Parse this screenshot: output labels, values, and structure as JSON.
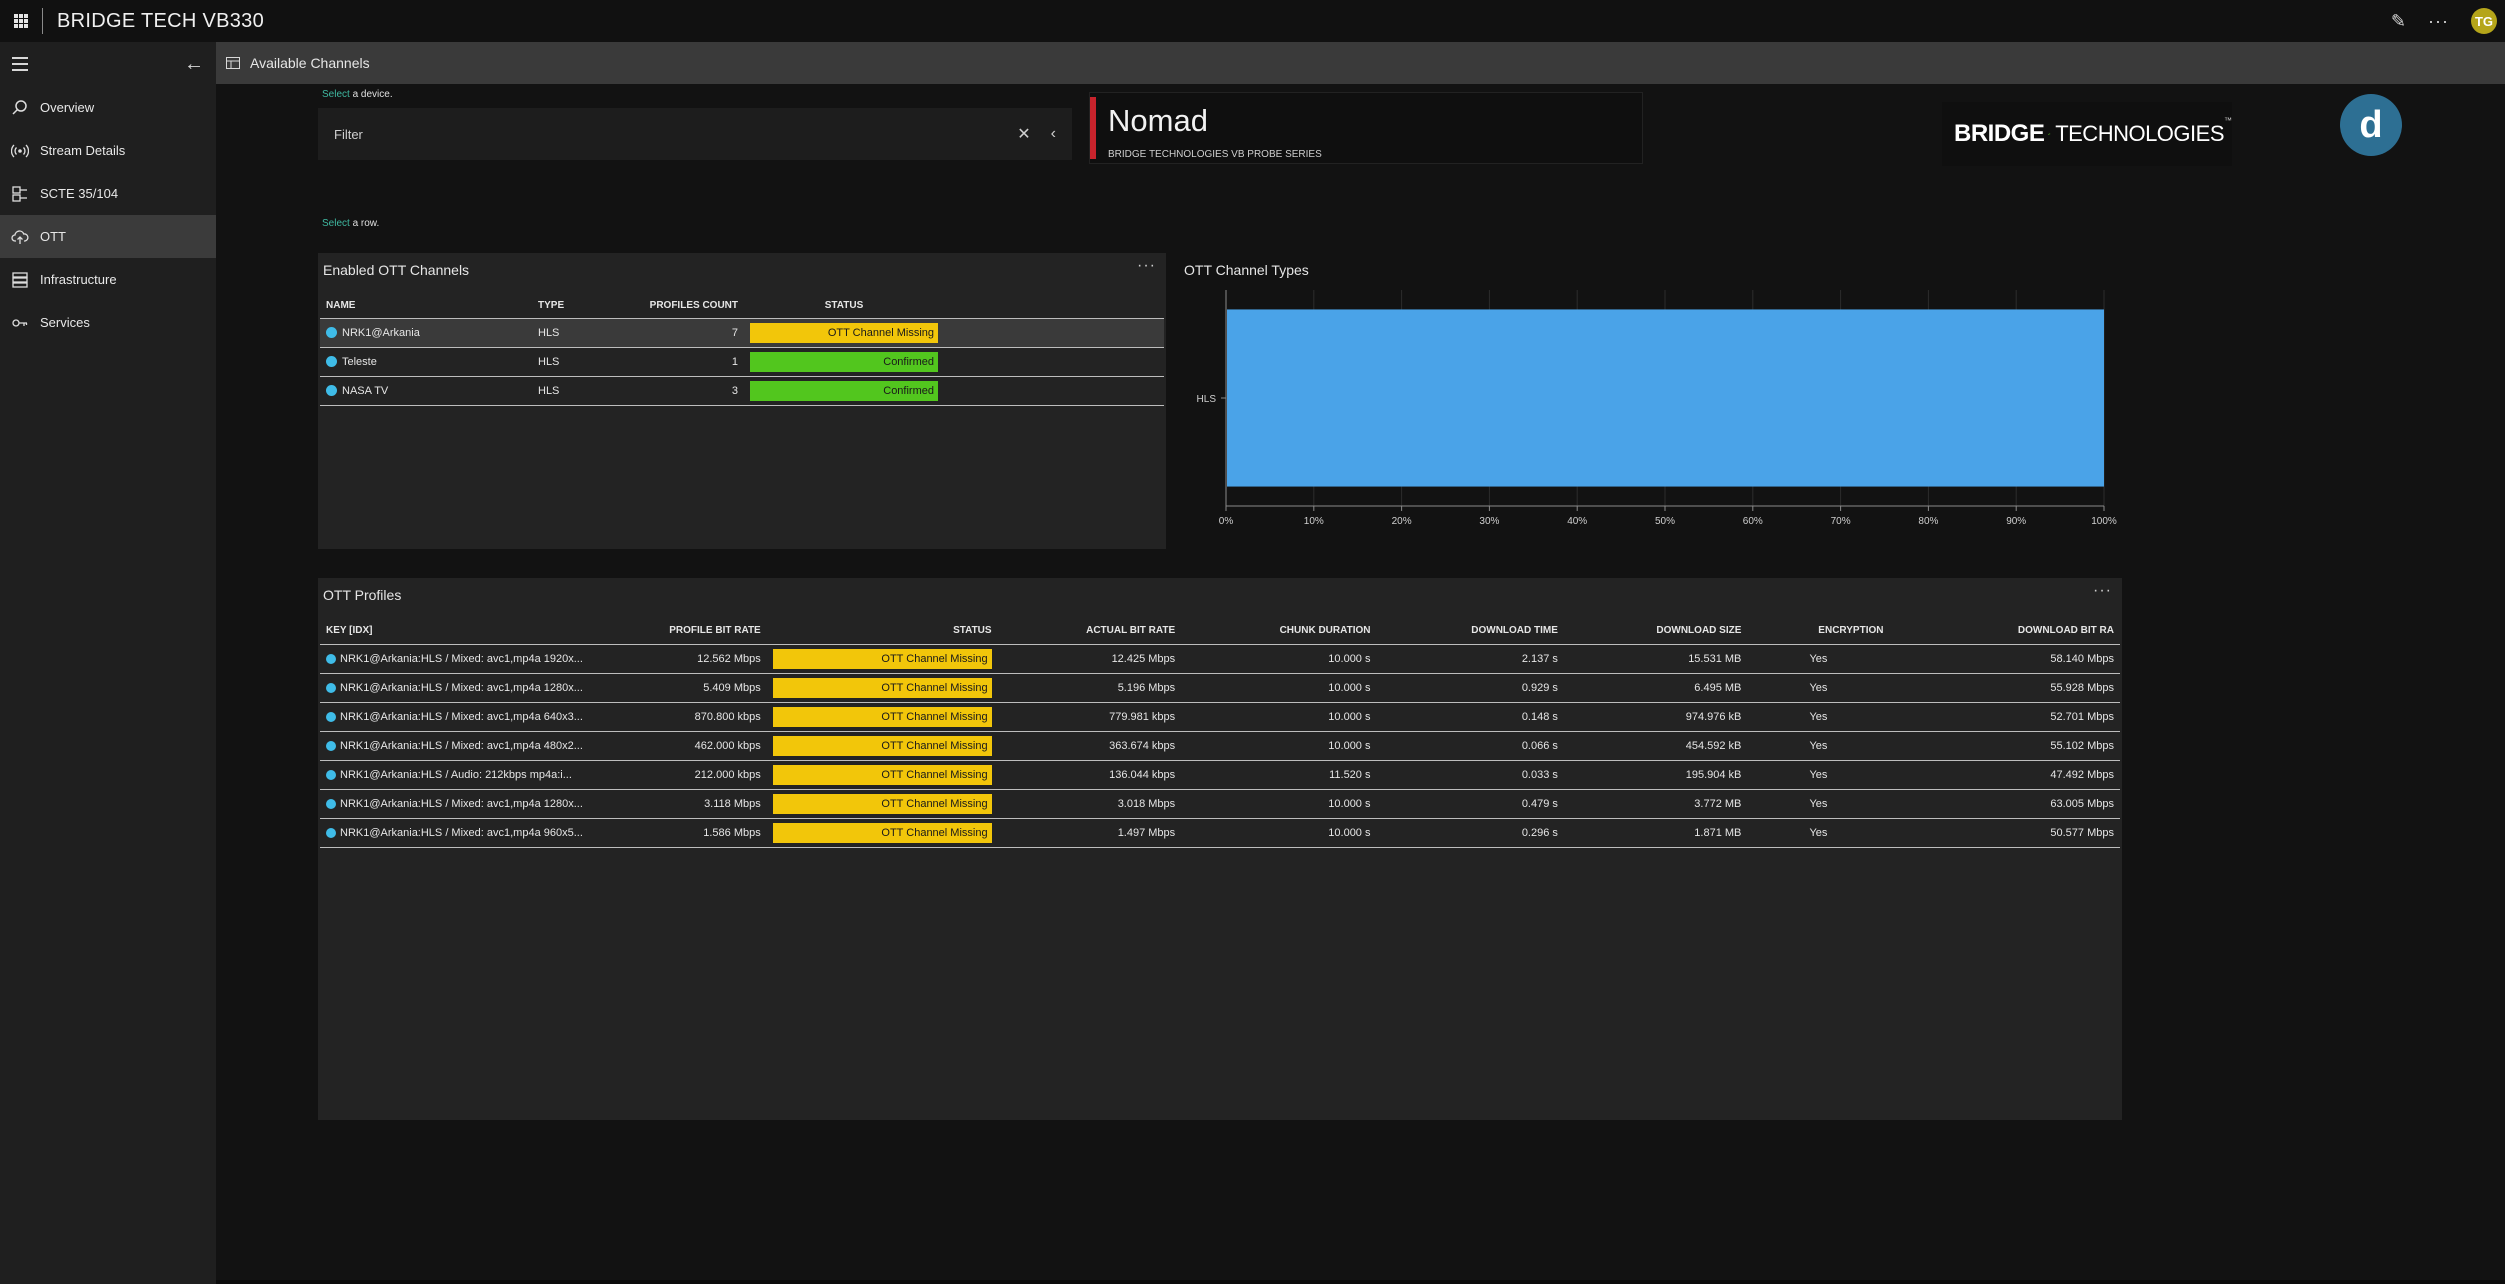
{
  "app": {
    "title": "BRIDGE TECH VB330",
    "user_initials": "TG"
  },
  "icons": {
    "apps": "waffle-icon",
    "edit": "pencil-icon",
    "more": "ellipsis-icon",
    "menu": "hamburger-icon",
    "back": "arrow-left-icon"
  },
  "sidebar": {
    "items": [
      {
        "label": "Overview",
        "icon": "search-icon"
      },
      {
        "label": "Stream Details",
        "icon": "broadcast-icon"
      },
      {
        "label": "SCTE 35/104",
        "icon": "splice-icon"
      },
      {
        "label": "OTT",
        "icon": "cloud-upload-icon",
        "active": true
      },
      {
        "label": "Infrastructure",
        "icon": "server-icon"
      },
      {
        "label": "Services",
        "icon": "key-icon"
      }
    ]
  },
  "subheader": {
    "title": "Available Channels"
  },
  "hints": {
    "device": {
      "accent": "Select",
      "rest": " a device."
    },
    "row": {
      "accent": "Select",
      "rest": " a row."
    }
  },
  "filter": {
    "placeholder": "Filter"
  },
  "device": {
    "name": "Nomad",
    "subtitle": "BRIDGE TECHNOLOGIES VB PROBE SERIES"
  },
  "brand": {
    "word1": "BRIDGE",
    "word2": "TECHNOLOGIES",
    "tm": "™",
    "d_logo": "d"
  },
  "colors": {
    "accent": "#3fb8a0",
    "missing": "#f2c60a",
    "confirmed": "#52c61e",
    "bar": "#4aa3e8",
    "dot": "#3fbce8",
    "device_bar": "#c8232c"
  },
  "channels": {
    "title": "Enabled OTT Channels",
    "menu": "···",
    "columns": [
      "NAME",
      "TYPE",
      "PROFILES COUNT",
      "STATUS"
    ],
    "rows": [
      {
        "name": "NRK1@Arkania",
        "type": "HLS",
        "profiles": "7",
        "status": "OTT Channel Missing",
        "status_type": "missing",
        "selected": true
      },
      {
        "name": "Teleste",
        "type": "HLS",
        "profiles": "1",
        "status": "Confirmed",
        "status_type": "confirmed"
      },
      {
        "name": "NASA TV",
        "type": "HLS",
        "profiles": "3",
        "status": "Confirmed",
        "status_type": "confirmed"
      }
    ]
  },
  "chart_data": {
    "type": "bar",
    "title": "OTT Channel Types",
    "orientation": "horizontal",
    "categories": [
      "HLS"
    ],
    "values": [
      100
    ],
    "xlim": [
      0,
      100
    ],
    "x_ticks": [
      "0%",
      "10%",
      "20%",
      "30%",
      "40%",
      "50%",
      "60%",
      "70%",
      "80%",
      "90%",
      "100%"
    ],
    "grid": true,
    "bar_color": "#4aa3e8"
  },
  "profiles": {
    "title": "OTT Profiles",
    "menu": "···",
    "columns": [
      "KEY [IDX]",
      "PROFILE BIT RATE",
      "STATUS",
      "ACTUAL BIT RATE",
      "CHUNK DURATION",
      "DOWNLOAD TIME",
      "DOWNLOAD SIZE",
      "ENCRYPTION",
      "DOWNLOAD BIT RA"
    ],
    "rows": [
      {
        "key": "NRK1@Arkania:HLS / Mixed: avc1,mp4a 1920x...",
        "pbr": "12.562 Mbps",
        "status": "OTT Channel Missing",
        "abr": "12.425 Mbps",
        "chunk": "10.000 s",
        "dtime": "2.137 s",
        "dsize": "15.531 MB",
        "enc": "Yes",
        "dbr": "58.140 Mbps"
      },
      {
        "key": "NRK1@Arkania:HLS / Mixed: avc1,mp4a 1280x...",
        "pbr": "5.409 Mbps",
        "status": "OTT Channel Missing",
        "abr": "5.196 Mbps",
        "chunk": "10.000 s",
        "dtime": "0.929 s",
        "dsize": "6.495 MB",
        "enc": "Yes",
        "dbr": "55.928 Mbps"
      },
      {
        "key": "NRK1@Arkania:HLS / Mixed: avc1,mp4a 640x3...",
        "pbr": "870.800 kbps",
        "status": "OTT Channel Missing",
        "abr": "779.981 kbps",
        "chunk": "10.000 s",
        "dtime": "0.148 s",
        "dsize": "974.976 kB",
        "enc": "Yes",
        "dbr": "52.701 Mbps"
      },
      {
        "key": "NRK1@Arkania:HLS / Mixed: avc1,mp4a 480x2...",
        "pbr": "462.000 kbps",
        "status": "OTT Channel Missing",
        "abr": "363.674 kbps",
        "chunk": "10.000 s",
        "dtime": "0.066 s",
        "dsize": "454.592 kB",
        "enc": "Yes",
        "dbr": "55.102 Mbps"
      },
      {
        "key": "NRK1@Arkania:HLS / Audio: 212kbps mp4a:i...",
        "pbr": "212.000 kbps",
        "status": "OTT Channel Missing",
        "abr": "136.044 kbps",
        "chunk": "11.520 s",
        "dtime": "0.033 s",
        "dsize": "195.904 kB",
        "enc": "Yes",
        "dbr": "47.492 Mbps"
      },
      {
        "key": "NRK1@Arkania:HLS / Mixed: avc1,mp4a 1280x...",
        "pbr": "3.118 Mbps",
        "status": "OTT Channel Missing",
        "abr": "3.018 Mbps",
        "chunk": "10.000 s",
        "dtime": "0.479 s",
        "dsize": "3.772 MB",
        "enc": "Yes",
        "dbr": "63.005 Mbps"
      },
      {
        "key": "NRK1@Arkania:HLS / Mixed: avc1,mp4a 960x5...",
        "pbr": "1.586 Mbps",
        "status": "OTT Channel Missing",
        "abr": "1.497 Mbps",
        "chunk": "10.000 s",
        "dtime": "0.296 s",
        "dsize": "1.871 MB",
        "enc": "Yes",
        "dbr": "50.577 Mbps"
      }
    ]
  }
}
